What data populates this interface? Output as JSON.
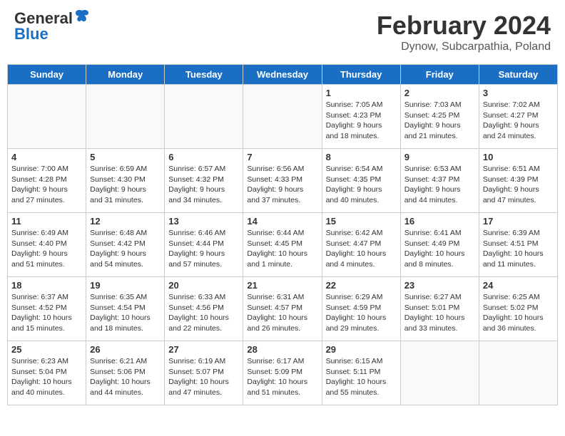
{
  "header": {
    "logo_general": "General",
    "logo_blue": "Blue",
    "main_title": "February 2024",
    "subtitle": "Dynow, Subcarpathia, Poland"
  },
  "days_of_week": [
    "Sunday",
    "Monday",
    "Tuesday",
    "Wednesday",
    "Thursday",
    "Friday",
    "Saturday"
  ],
  "weeks": [
    [
      {
        "day": "",
        "info": ""
      },
      {
        "day": "",
        "info": ""
      },
      {
        "day": "",
        "info": ""
      },
      {
        "day": "",
        "info": ""
      },
      {
        "day": "1",
        "info": "Sunrise: 7:05 AM\nSunset: 4:23 PM\nDaylight: 9 hours\nand 18 minutes."
      },
      {
        "day": "2",
        "info": "Sunrise: 7:03 AM\nSunset: 4:25 PM\nDaylight: 9 hours\nand 21 minutes."
      },
      {
        "day": "3",
        "info": "Sunrise: 7:02 AM\nSunset: 4:27 PM\nDaylight: 9 hours\nand 24 minutes."
      }
    ],
    [
      {
        "day": "4",
        "info": "Sunrise: 7:00 AM\nSunset: 4:28 PM\nDaylight: 9 hours\nand 27 minutes."
      },
      {
        "day": "5",
        "info": "Sunrise: 6:59 AM\nSunset: 4:30 PM\nDaylight: 9 hours\nand 31 minutes."
      },
      {
        "day": "6",
        "info": "Sunrise: 6:57 AM\nSunset: 4:32 PM\nDaylight: 9 hours\nand 34 minutes."
      },
      {
        "day": "7",
        "info": "Sunrise: 6:56 AM\nSunset: 4:33 PM\nDaylight: 9 hours\nand 37 minutes."
      },
      {
        "day": "8",
        "info": "Sunrise: 6:54 AM\nSunset: 4:35 PM\nDaylight: 9 hours\nand 40 minutes."
      },
      {
        "day": "9",
        "info": "Sunrise: 6:53 AM\nSunset: 4:37 PM\nDaylight: 9 hours\nand 44 minutes."
      },
      {
        "day": "10",
        "info": "Sunrise: 6:51 AM\nSunset: 4:39 PM\nDaylight: 9 hours\nand 47 minutes."
      }
    ],
    [
      {
        "day": "11",
        "info": "Sunrise: 6:49 AM\nSunset: 4:40 PM\nDaylight: 9 hours\nand 51 minutes."
      },
      {
        "day": "12",
        "info": "Sunrise: 6:48 AM\nSunset: 4:42 PM\nDaylight: 9 hours\nand 54 minutes."
      },
      {
        "day": "13",
        "info": "Sunrise: 6:46 AM\nSunset: 4:44 PM\nDaylight: 9 hours\nand 57 minutes."
      },
      {
        "day": "14",
        "info": "Sunrise: 6:44 AM\nSunset: 4:45 PM\nDaylight: 10 hours\nand 1 minute."
      },
      {
        "day": "15",
        "info": "Sunrise: 6:42 AM\nSunset: 4:47 PM\nDaylight: 10 hours\nand 4 minutes."
      },
      {
        "day": "16",
        "info": "Sunrise: 6:41 AM\nSunset: 4:49 PM\nDaylight: 10 hours\nand 8 minutes."
      },
      {
        "day": "17",
        "info": "Sunrise: 6:39 AM\nSunset: 4:51 PM\nDaylight: 10 hours\nand 11 minutes."
      }
    ],
    [
      {
        "day": "18",
        "info": "Sunrise: 6:37 AM\nSunset: 4:52 PM\nDaylight: 10 hours\nand 15 minutes."
      },
      {
        "day": "19",
        "info": "Sunrise: 6:35 AM\nSunset: 4:54 PM\nDaylight: 10 hours\nand 18 minutes."
      },
      {
        "day": "20",
        "info": "Sunrise: 6:33 AM\nSunset: 4:56 PM\nDaylight: 10 hours\nand 22 minutes."
      },
      {
        "day": "21",
        "info": "Sunrise: 6:31 AM\nSunset: 4:57 PM\nDaylight: 10 hours\nand 26 minutes."
      },
      {
        "day": "22",
        "info": "Sunrise: 6:29 AM\nSunset: 4:59 PM\nDaylight: 10 hours\nand 29 minutes."
      },
      {
        "day": "23",
        "info": "Sunrise: 6:27 AM\nSunset: 5:01 PM\nDaylight: 10 hours\nand 33 minutes."
      },
      {
        "day": "24",
        "info": "Sunrise: 6:25 AM\nSunset: 5:02 PM\nDaylight: 10 hours\nand 36 minutes."
      }
    ],
    [
      {
        "day": "25",
        "info": "Sunrise: 6:23 AM\nSunset: 5:04 PM\nDaylight: 10 hours\nand 40 minutes."
      },
      {
        "day": "26",
        "info": "Sunrise: 6:21 AM\nSunset: 5:06 PM\nDaylight: 10 hours\nand 44 minutes."
      },
      {
        "day": "27",
        "info": "Sunrise: 6:19 AM\nSunset: 5:07 PM\nDaylight: 10 hours\nand 47 minutes."
      },
      {
        "day": "28",
        "info": "Sunrise: 6:17 AM\nSunset: 5:09 PM\nDaylight: 10 hours\nand 51 minutes."
      },
      {
        "day": "29",
        "info": "Sunrise: 6:15 AM\nSunset: 5:11 PM\nDaylight: 10 hours\nand 55 minutes."
      },
      {
        "day": "",
        "info": ""
      },
      {
        "day": "",
        "info": ""
      }
    ]
  ]
}
